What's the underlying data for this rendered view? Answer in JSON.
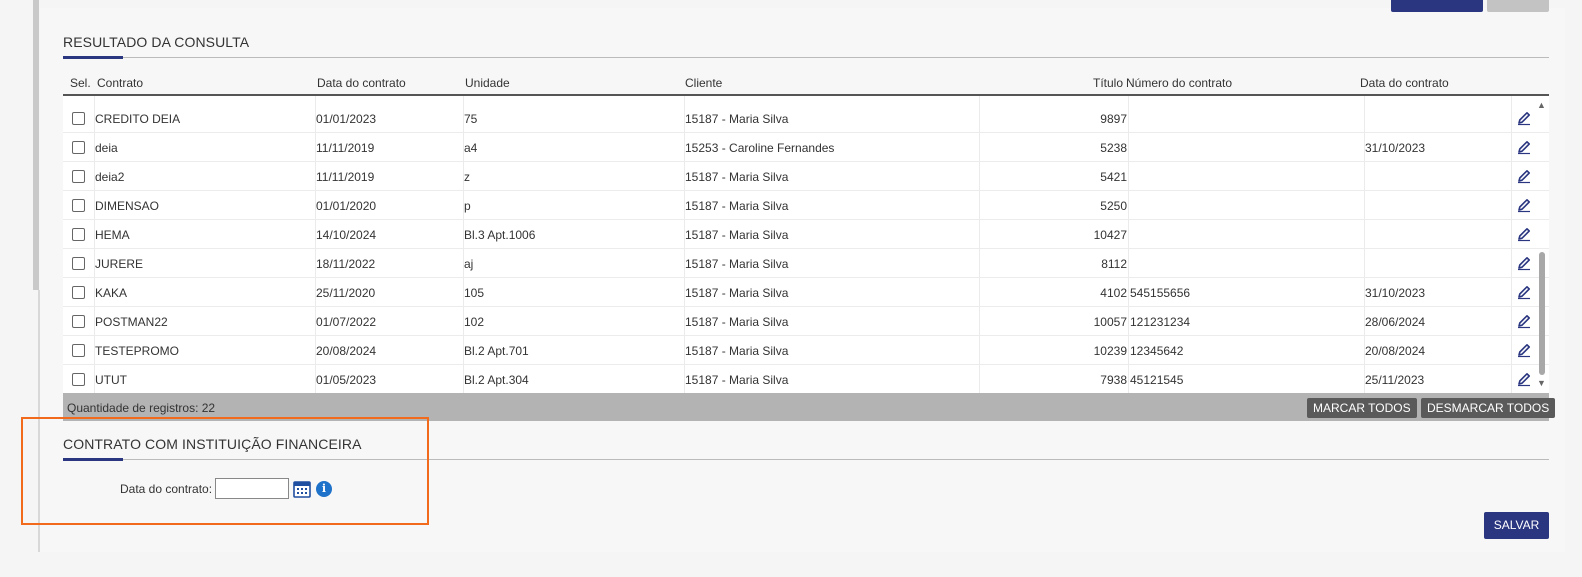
{
  "section_results": {
    "title": "RESULTADO DA CONSULTA"
  },
  "table": {
    "headers": [
      "Sel.",
      "Contrato",
      "Data do contrato",
      "Unidade",
      "Cliente",
      "Título",
      "Número do contrato",
      "Data do contrato"
    ],
    "rows": [
      {
        "contrato": "CREDITO DEIA",
        "data": "01/01/2023",
        "unidade": "75",
        "cliente": "15187 - Maria Silva",
        "titulo": "9897",
        "numero": "",
        "data_contrato": ""
      },
      {
        "contrato": "deia",
        "data": "11/11/2019",
        "unidade": "a4",
        "cliente": "15253 - Caroline Fernandes",
        "titulo": "5238",
        "numero": "",
        "data_contrato": "31/10/2023"
      },
      {
        "contrato": "deia2",
        "data": "11/11/2019",
        "unidade": "z",
        "cliente": "15187 - Maria Silva",
        "titulo": "5421",
        "numero": "",
        "data_contrato": ""
      },
      {
        "contrato": "DIMENSAO",
        "data": "01/01/2020",
        "unidade": "p",
        "cliente": "15187 - Maria Silva",
        "titulo": "5250",
        "numero": "",
        "data_contrato": ""
      },
      {
        "contrato": "HEMA",
        "data": "14/10/2024",
        "unidade": "Bl.3 Apt.1006",
        "cliente": "15187 - Maria Silva",
        "titulo": "10427",
        "numero": "",
        "data_contrato": ""
      },
      {
        "contrato": "JURERE",
        "data": "18/11/2022",
        "unidade": "aj",
        "cliente": "15187 - Maria Silva",
        "titulo": "8112",
        "numero": "",
        "data_contrato": ""
      },
      {
        "contrato": "KAKA",
        "data": "25/11/2020",
        "unidade": "105",
        "cliente": "15187 - Maria Silva",
        "titulo": "4102",
        "numero": "545155656",
        "data_contrato": "31/10/2023"
      },
      {
        "contrato": "POSTMAN22",
        "data": "01/07/2022",
        "unidade": "102",
        "cliente": "15187 - Maria Silva",
        "titulo": "10057",
        "numero": "121231234",
        "data_contrato": "28/06/2024"
      },
      {
        "contrato": "TESTEPROMO",
        "data": "20/08/2024",
        "unidade": "Bl.2 Apt.701",
        "cliente": "15187 - Maria Silva",
        "titulo": "10239",
        "numero": "12345642",
        "data_contrato": "20/08/2024"
      },
      {
        "contrato": "UTUT",
        "data": "01/05/2023",
        "unidade": "Bl.2 Apt.304",
        "cliente": "15187 - Maria Silva",
        "titulo": "7938",
        "numero": "45121545",
        "data_contrato": "25/11/2023"
      }
    ]
  },
  "footer": {
    "count_label": "Quantidade de registros: 22",
    "select_all": "MARCAR TODOS",
    "deselect_all": "DESMARCAR TODOS"
  },
  "section_financial": {
    "title": "CONTRATO COM INSTITUIÇÃO FINANCEIRA",
    "date_label": "Data do contrato:",
    "date_value": ""
  },
  "actions": {
    "save": "SALVAR"
  },
  "colors": {
    "primary": "#2a3680",
    "highlight": "#f26a1b",
    "footer_bg": "#b3b3b3"
  },
  "icons": [
    "edit-pencil-icon",
    "calendar-icon",
    "info-icon",
    "scroll-up-icon",
    "scroll-down-icon"
  ]
}
